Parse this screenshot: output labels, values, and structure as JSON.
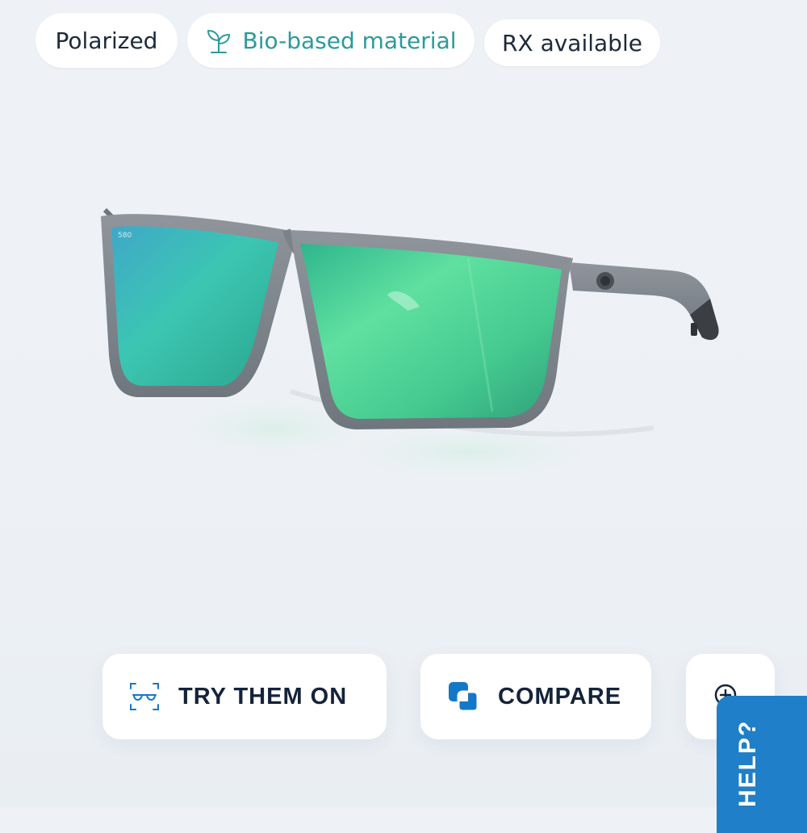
{
  "badges": {
    "polarized": "Polarized",
    "bio_based": "Bio-based material",
    "rx": "RX available"
  },
  "product": {
    "lens_logo_text": "580"
  },
  "actions": {
    "try_on_label": "TRY THEM ON",
    "compare_label": "COMPARE"
  },
  "help": {
    "label": "HELP?"
  },
  "icons": {
    "bio": "leaf-icon",
    "try_on": "glasses-scan-icon",
    "compare": "compare-squares-icon",
    "zoom": "zoom-in-icon"
  },
  "colors": {
    "bio_accent": "#2c9a9a",
    "compare_blue": "#1478c8",
    "help_bg": "#1f7fc8",
    "lens_green": "#4bd79a",
    "frame_grey": "#8a9096"
  }
}
